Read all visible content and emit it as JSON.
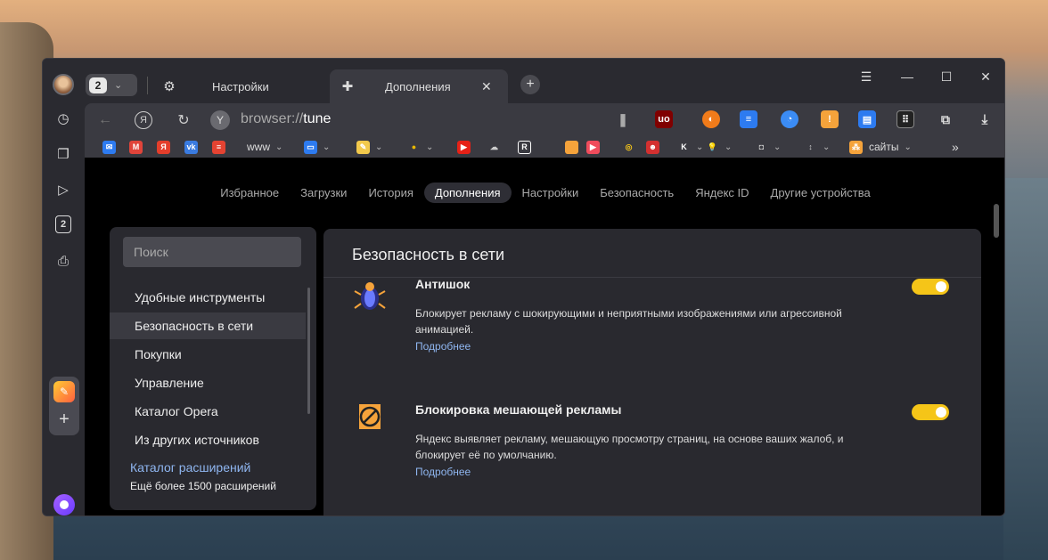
{
  "tabs": {
    "count": "2",
    "settings_label": "Настройки",
    "addons_label": "Дополнения"
  },
  "window": {
    "menu_glyph": "☰",
    "minimize_glyph": "—",
    "maximize_glyph": "☐",
    "close_glyph": "✕"
  },
  "address": {
    "url_prefix": "browser://",
    "url_path": "tune"
  },
  "sidebar_counter": "2",
  "bookmarks": [
    {
      "label": "",
      "icon": "mail-icon",
      "color": "#2d7bf0",
      "glyph": "✉"
    },
    {
      "label": "",
      "icon": "gmail-icon",
      "color": "#e0443a",
      "glyph": "M"
    },
    {
      "label": "",
      "icon": "yandex-icon",
      "color": "#e43e2b",
      "glyph": "Я"
    },
    {
      "label": "",
      "icon": "vk-icon",
      "color": "#3a7be0",
      "glyph": "vk"
    },
    {
      "label": "",
      "icon": "todoist-icon",
      "color": "#e44332",
      "glyph": "≡"
    },
    {
      "label": "www",
      "icon": "",
      "color": "",
      "glyph": ""
    },
    {
      "label": "",
      "icon": "folder-blue-icon",
      "color": "#2d7bf0",
      "glyph": "▭"
    },
    {
      "label": "",
      "icon": "notes-icon",
      "color": "#f2c94c",
      "glyph": "✎"
    },
    {
      "label": "",
      "icon": "pear-icon",
      "color": "#e8b700",
      "glyph": "●"
    },
    {
      "label": "",
      "icon": "youtube-icon",
      "color": "#e62117",
      "glyph": "▶"
    },
    {
      "label": "",
      "icon": "cloud-icon",
      "color": "#cccccc",
      "glyph": "☁"
    },
    {
      "label": "",
      "icon": "r-icon",
      "color": "#ffffff",
      "glyph": "R"
    },
    {
      "label": "",
      "icon": "orange-square-icon",
      "color": "#f5a33b",
      "glyph": ""
    },
    {
      "label": "",
      "icon": "video-icon",
      "color": "#f04c5c",
      "glyph": "▶"
    },
    {
      "label": "",
      "icon": "spiral-icon",
      "color": "#f5c518",
      "glyph": "◎"
    },
    {
      "label": "",
      "icon": "mask-icon",
      "color": "#d33030",
      "glyph": "☻"
    },
    {
      "label": "",
      "icon": "k-icon",
      "color": "#ffffff",
      "glyph": "K"
    },
    {
      "label": "",
      "icon": "bulb-icon",
      "color": "#f5c518",
      "glyph": "💡"
    },
    {
      "label": "",
      "icon": "robot-icon",
      "color": "#cccccc",
      "glyph": "◘"
    },
    {
      "label": "",
      "icon": "updown-icon",
      "color": "#cccccc",
      "glyph": "↕"
    },
    {
      "label": "сайты",
      "icon": "sites-icon",
      "color": "#f5a33b",
      "glyph": "⁂"
    }
  ],
  "page_nav": [
    "Избранное",
    "Загрузки",
    "История",
    "Дополнения",
    "Настройки",
    "Безопасность",
    "Яндекс ID",
    "Другие устройства"
  ],
  "sidebar": {
    "search_placeholder": "Поиск",
    "items": [
      "Удобные инструменты",
      "Безопасность в сети",
      "Покупки",
      "Управление",
      "Каталог Opera",
      "Из других источников"
    ],
    "catalog_link": "Каталог расширений",
    "catalog_sub": "Ещё более 1500 расширений"
  },
  "section": {
    "title": "Безопасность в сети",
    "extensions": [
      {
        "name": "Антишок",
        "description": "Блокирует рекламу с шокирующими и неприятными изображениями или агрессивной анимацией.",
        "more": "Подробнее",
        "enabled": true
      },
      {
        "name": "Блокировка мешающей рекламы",
        "description": "Яндекс выявляет рекламу, мешающую просмотру страниц, на основе ваших жалоб, и блокирует её по умолчанию.",
        "more": "Подробнее",
        "enabled": true
      }
    ]
  },
  "colors": {
    "accent_toggle": "#f5c518",
    "link": "#8fb6f0"
  }
}
